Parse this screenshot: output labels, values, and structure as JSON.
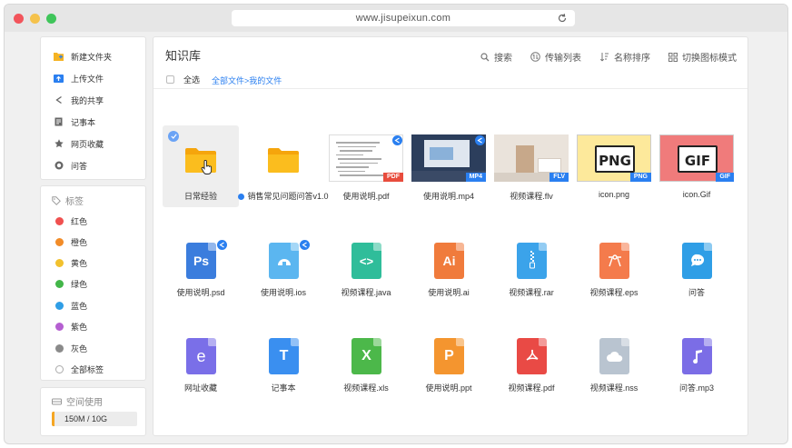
{
  "browser": {
    "url": "www.jisupeixun.com"
  },
  "nav": {
    "items": [
      {
        "label": "新建文件夹",
        "icon": "new-folder-icon"
      },
      {
        "label": "上传文件",
        "icon": "upload-icon"
      },
      {
        "label": "我的共享",
        "icon": "share-icon"
      },
      {
        "label": "记事本",
        "icon": "notepad-icon"
      },
      {
        "label": "网页收藏",
        "icon": "star-icon"
      },
      {
        "label": "问答",
        "icon": "qa-icon"
      }
    ]
  },
  "tags": {
    "title": "标签",
    "items": [
      {
        "label": "红色",
        "color": "#f0504f"
      },
      {
        "label": "橙色",
        "color": "#f28c28"
      },
      {
        "label": "黄色",
        "color": "#f2c12e"
      },
      {
        "label": "绿色",
        "color": "#43b649"
      },
      {
        "label": "蓝色",
        "color": "#2f9ee6"
      },
      {
        "label": "紫色",
        "color": "#b55fd1"
      },
      {
        "label": "灰色",
        "color": "#8a8a8a"
      },
      {
        "label": "全部标签",
        "color": ""
      }
    ]
  },
  "space": {
    "title": "空间使用",
    "usage": "150M / 10G",
    "used_fraction": 0.015
  },
  "main": {
    "title": "知识库",
    "toolbar": {
      "search": "搜索",
      "transfer": "传输列表",
      "sort": "名称排序",
      "view": "切换图标模式"
    },
    "select_all": "全选",
    "breadcrumb": "全部文件>我的文件"
  },
  "files": [
    {
      "name": "日常经验",
      "kind": "folder",
      "selected": true
    },
    {
      "name": "销售常见问题问答v1.0",
      "kind": "folder",
      "shared": true
    },
    {
      "name": "使用说明.pdf",
      "kind": "thumb-doc",
      "badge": "PDF",
      "badge_color": "#e84c3d",
      "shared": true
    },
    {
      "name": "使用说明.mp4",
      "kind": "thumb-video",
      "badge": "MP4",
      "badge_color": "#2a7ff0",
      "shared": true
    },
    {
      "name": "视频课程.flv",
      "kind": "thumb-room",
      "badge": "FLV",
      "badge_color": "#2a7ff0"
    },
    {
      "name": "icon.png",
      "kind": "thumb-png",
      "badge": "PNG",
      "badge_color": "#2a7ff0",
      "text": "PNG"
    },
    {
      "name": "icon.Gif",
      "kind": "thumb-gif",
      "badge": "GIF",
      "badge_color": "#2a7ff0",
      "text": "GIF"
    },
    {
      "name": "使用说明.psd",
      "kind": "file",
      "glyph": "Ps",
      "color": "#3b7ddd",
      "shared": true
    },
    {
      "name": "使用说明.ios",
      "kind": "file",
      "glyph": "ios",
      "color": "#5bb6f0",
      "shared": true
    },
    {
      "name": "视频课程.java",
      "kind": "file",
      "glyph": "<>",
      "color": "#2fbd9a"
    },
    {
      "name": "使用说明.ai",
      "kind": "file",
      "glyph": "Ai",
      "color": "#f07b3c"
    },
    {
      "name": "视频课程.rar",
      "kind": "file",
      "glyph": "zip",
      "color": "#3ba3ea"
    },
    {
      "name": "视频课程.eps",
      "kind": "file",
      "glyph": "eps",
      "color": "#f47b4c"
    },
    {
      "name": "问答",
      "kind": "file",
      "glyph": "qa",
      "color": "#2f9ee6"
    },
    {
      "name": "网址收藏",
      "kind": "file",
      "glyph": "e",
      "color": "#7a6fe8"
    },
    {
      "name": "记事本",
      "kind": "file",
      "glyph": "T",
      "color": "#3a8ff0"
    },
    {
      "name": "视频课程.xls",
      "kind": "file",
      "glyph": "X",
      "color": "#4cb84a"
    },
    {
      "name": "使用说明.ppt",
      "kind": "file",
      "glyph": "P",
      "color": "#f4952f"
    },
    {
      "name": "视频课程.pdf",
      "kind": "file",
      "glyph": "pdf",
      "color": "#e94a45"
    },
    {
      "name": "视频课程.nss",
      "kind": "file",
      "glyph": "cloud",
      "color": "#b9c4d0"
    },
    {
      "name": "问答.mp3",
      "kind": "file",
      "glyph": "music",
      "color": "#7b6de6"
    }
  ]
}
